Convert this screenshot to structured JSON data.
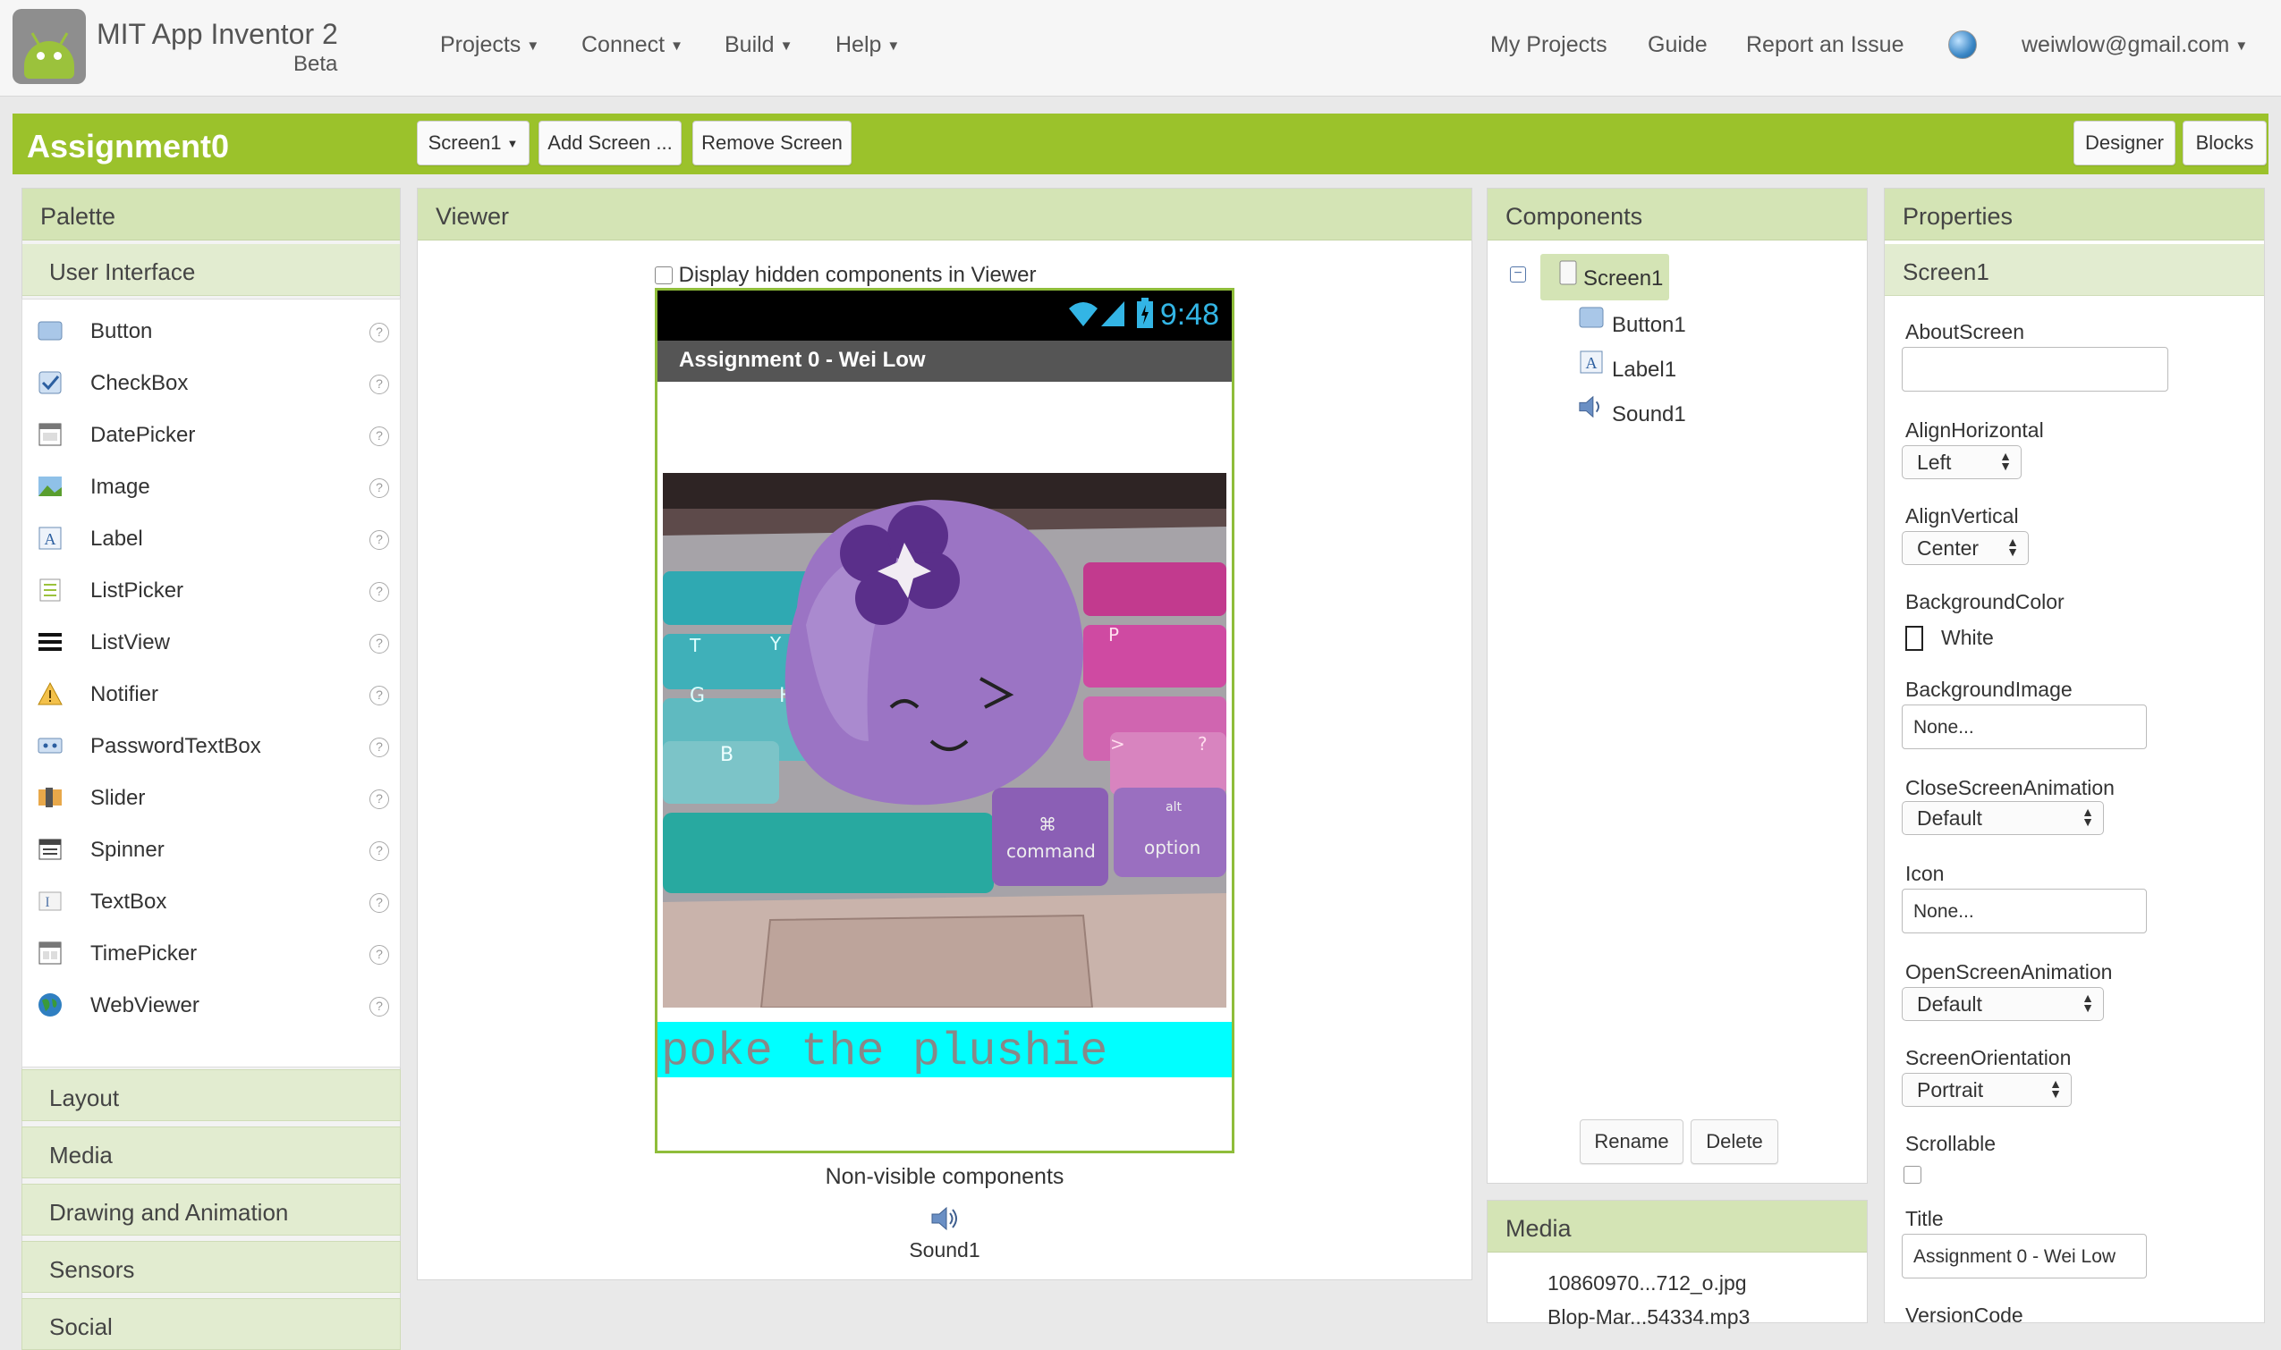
{
  "app": {
    "title": "MIT App Inventor 2",
    "subtitle": "Beta"
  },
  "nav": {
    "left": [
      {
        "label": "Projects"
      },
      {
        "label": "Connect"
      },
      {
        "label": "Build"
      },
      {
        "label": "Help"
      }
    ],
    "right": {
      "my_projects": "My Projects",
      "guide": "Guide",
      "report": "Report an Issue",
      "user": "weiwlow@gmail.com"
    }
  },
  "project": {
    "name": "Assignment0",
    "screen_select": "Screen1",
    "add_screen": "Add Screen ...",
    "remove_screen": "Remove Screen",
    "designer": "Designer",
    "blocks": "Blocks"
  },
  "palette": {
    "title": "Palette",
    "open_category": "User Interface",
    "items": [
      {
        "label": "Button",
        "icon": "button-icon"
      },
      {
        "label": "CheckBox",
        "icon": "checkbox-icon"
      },
      {
        "label": "DatePicker",
        "icon": "datepicker-icon"
      },
      {
        "label": "Image",
        "icon": "image-icon"
      },
      {
        "label": "Label",
        "icon": "label-icon"
      },
      {
        "label": "ListPicker",
        "icon": "listpicker-icon"
      },
      {
        "label": "ListView",
        "icon": "listview-icon"
      },
      {
        "label": "Notifier",
        "icon": "notifier-icon"
      },
      {
        "label": "PasswordTextBox",
        "icon": "password-icon"
      },
      {
        "label": "Slider",
        "icon": "slider-icon"
      },
      {
        "label": "Spinner",
        "icon": "spinner-icon"
      },
      {
        "label": "TextBox",
        "icon": "textbox-icon"
      },
      {
        "label": "TimePicker",
        "icon": "timepicker-icon"
      },
      {
        "label": "WebViewer",
        "icon": "webviewer-icon"
      }
    ],
    "help_glyph": "?",
    "categories": [
      "Layout",
      "Media",
      "Drawing and Animation",
      "Sensors",
      "Social"
    ]
  },
  "viewer": {
    "title": "Viewer",
    "hidden_checkbox_label": "Display hidden components in Viewer",
    "phone": {
      "time": "9:48",
      "screen_title": "Assignment 0 - Wei Low",
      "label_text": "poke the plushie",
      "label_bg": "#00ffff",
      "keyboard_keys": {
        "command": "command",
        "option": "option",
        "cmd_symbol": "⌘",
        "alt": "alt",
        "t": "T",
        "y": "Y",
        "g": "G",
        "h": "H",
        "b": "B",
        "p": "P",
        "q": "?",
        "gt": ">"
      }
    },
    "nonvisible_title": "Non-visible components",
    "nonvisible_item": "Sound1"
  },
  "components": {
    "title": "Components",
    "tree_toggle": "−",
    "items": [
      {
        "label": "Screen1",
        "icon": "screen-icon"
      },
      {
        "label": "Button1",
        "icon": "button-icon"
      },
      {
        "label": "Label1",
        "icon": "label-icon"
      },
      {
        "label": "Sound1",
        "icon": "sound-icon"
      }
    ],
    "rename": "Rename",
    "delete": "Delete"
  },
  "media": {
    "title": "Media",
    "items": [
      "10860970...712_o.jpg",
      "Blop-Mar...54334.mp3"
    ]
  },
  "properties": {
    "title": "Properties",
    "component": "Screen1",
    "about_label": "AboutScreen",
    "about_value": "",
    "align_h_label": "AlignHorizontal",
    "align_h_value": "Left",
    "align_v_label": "AlignVertical",
    "align_v_value": "Center",
    "bgcolor_label": "BackgroundColor",
    "bgcolor_value": "White",
    "bgimage_label": "BackgroundImage",
    "bgimage_value": "None...",
    "close_anim_label": "CloseScreenAnimation",
    "close_anim_value": "Default",
    "icon_label": "Icon",
    "icon_value": "None...",
    "open_anim_label": "OpenScreenAnimation",
    "open_anim_value": "Default",
    "orientation_label": "ScreenOrientation",
    "orientation_value": "Portrait",
    "scrollable_label": "Scrollable",
    "title_label": "Title",
    "title_value": "Assignment 0 - Wei Low",
    "version_label": "VersionCode"
  },
  "colors": {
    "accent": "#9bc22b",
    "panel_header": "#d4e4b5",
    "clock": "#33b5e5"
  }
}
